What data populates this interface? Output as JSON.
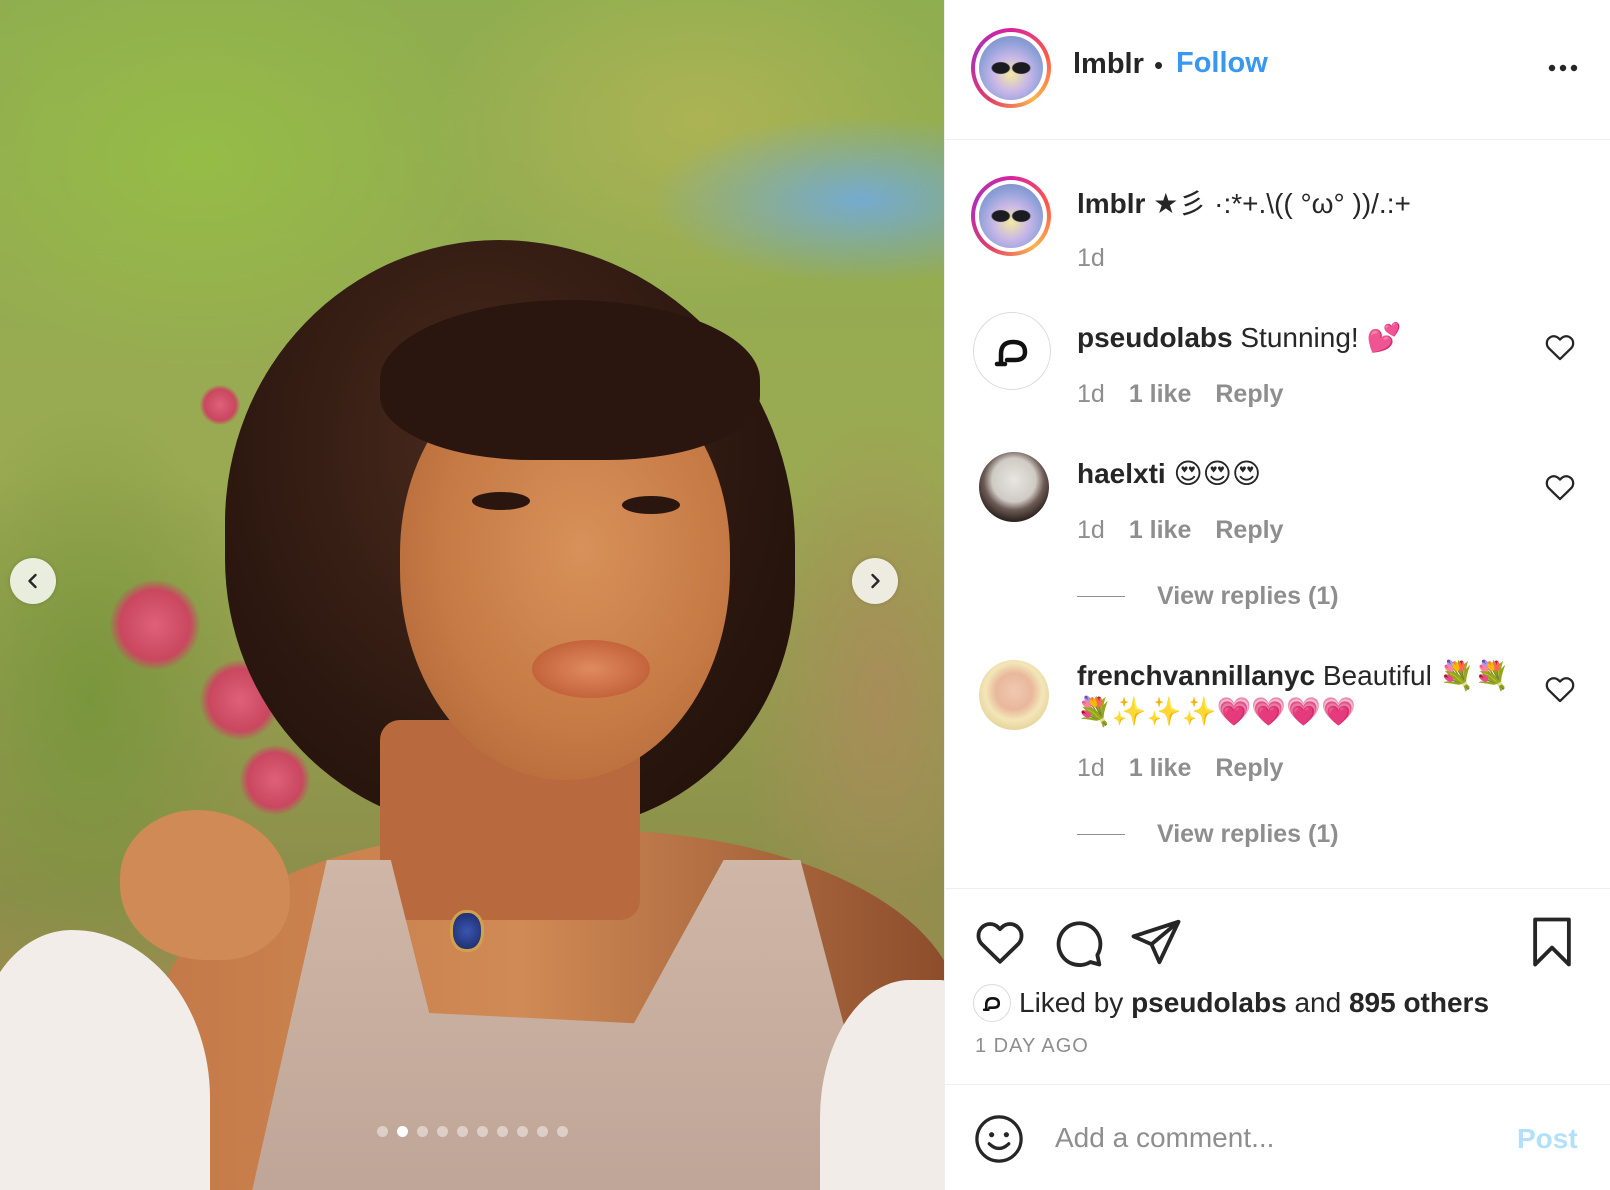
{
  "post": {
    "photo_alt": "",
    "carousel": {
      "total": 10,
      "active": 1
    }
  },
  "header": {
    "username": "lmblr",
    "separator": "•",
    "follow_label": "Follow",
    "more_icon": "more-horizontal-icon"
  },
  "caption": {
    "username": "lmblr",
    "text": "★彡 ·:*+.\\(( °ω° ))/.:+",
    "time": "1d"
  },
  "comments": [
    {
      "username": "pseudolabs",
      "text": "Stunning! 💕",
      "time": "1d",
      "likes": "1 like",
      "reply_label": "Reply",
      "view_replies": null
    },
    {
      "username": "haelxti",
      "text": "😍😍😍",
      "time": "1d",
      "likes": "1 like",
      "reply_label": "Reply",
      "view_replies": "View replies (1)"
    },
    {
      "username": "frenchvannillanyc",
      "text": "Beautiful 💐💐💐✨✨✨💗💗💗💗",
      "time": "1d",
      "likes": "1 like",
      "reply_label": "Reply",
      "view_replies": "View replies (1)"
    }
  ],
  "actions": {
    "like_icon": "heart-icon",
    "comment_icon": "comment-icon",
    "share_icon": "paper-plane-icon",
    "save_icon": "bookmark-icon",
    "liked_by_prefix": "Liked by",
    "liked_by_user": "pseudolabs",
    "liked_by_and": "and",
    "liked_by_others": "895 others",
    "timestamp": "1 DAY AGO"
  },
  "add_comment": {
    "placeholder": "Add a comment...",
    "post_label": "Post"
  },
  "colors": {
    "link_blue": "#3897f0",
    "post_disabled": "#b2dffc",
    "secondary_text": "#8e8e8e",
    "primary_text": "#262626",
    "divider": "#efefef"
  }
}
